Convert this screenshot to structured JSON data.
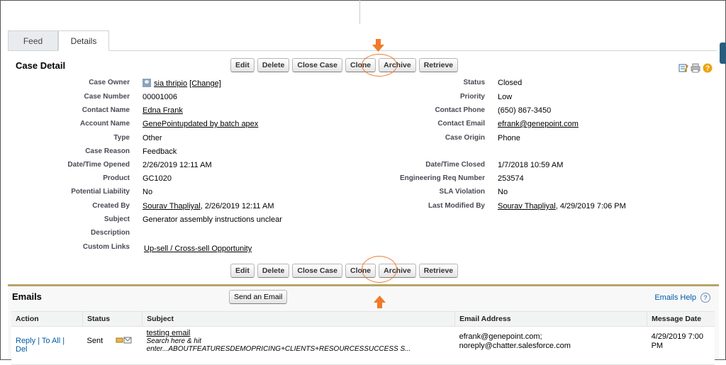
{
  "tabs": [
    "Feed",
    "Details"
  ],
  "case_detail": {
    "title": "Case Detail",
    "buttons": [
      "Edit",
      "Delete",
      "Close Case",
      "Clone",
      "Archive",
      "Retrieve"
    ],
    "left_fields": [
      {
        "label": "Case Owner",
        "value": "sia thripio",
        "extra": "[Change]"
      },
      {
        "label": "Case Number",
        "value": "00001006"
      },
      {
        "label": "Contact Name",
        "value": "Edna Frank"
      },
      {
        "label": "Account Name",
        "value": "GenePointupdated by batch apex"
      },
      {
        "label": "Type",
        "value": "Other"
      },
      {
        "label": "Case Reason",
        "value": "Feedback"
      },
      {
        "label": "Date/Time Opened",
        "value": "2/26/2019 12:11 AM"
      },
      {
        "label": "Product",
        "value": "GC1020"
      },
      {
        "label": "Potential Liability",
        "value": "No"
      },
      {
        "label": "Created By",
        "value": "Sourav Thapliyal",
        "extra": ", 2/26/2019 12:11 AM"
      },
      {
        "label": "Subject",
        "value": "Generator assembly instructions unclear"
      },
      {
        "label": "Description",
        "value": ""
      },
      {
        "label": "Custom Links",
        "value": "Up-sell / Cross-sell Opportunity"
      }
    ],
    "right_fields": [
      {
        "label": "Status",
        "value": "Closed"
      },
      {
        "label": "Priority",
        "value": "Low"
      },
      {
        "label": "Contact Phone",
        "value": "(650) 867-3450"
      },
      {
        "label": "Contact Email",
        "value": "efrank@genepoint.com"
      },
      {
        "label": "Case Origin",
        "value": "Phone"
      },
      {
        "label": "Date/Time Closed",
        "value": "1/7/2018 10:59 AM"
      },
      {
        "label": "Engineering Req Number",
        "value": "253574"
      },
      {
        "label": "SLA Violation",
        "value": "No"
      },
      {
        "label": "Last Modified By",
        "value": "Sourav Thapliyal",
        "extra": ", 4/29/2019 7:06 PM"
      }
    ]
  },
  "emails": {
    "title": "Emails",
    "send_button": "Send an Email",
    "help_link": "Emails Help",
    "help_icon": "?",
    "columns": [
      "Action",
      "Status",
      "Subject",
      "Email Address",
      "Message Date"
    ],
    "rows": [
      {
        "actions": [
          "Reply",
          "To All",
          "Del"
        ],
        "separator": "|",
        "status": "Sent",
        "subject": "testing email",
        "snippet": "Search here & hit enter...ABOUTFEATURESDEMOPRICING+CLIENTS+RESOURCESSUCCESS S...",
        "email_address": "efrank@genepoint.com; noreply@chatter.salesforce.com",
        "message_date": "4/29/2019 7:00 PM"
      }
    ]
  },
  "colors": {
    "highlight": "#f07a2a",
    "link": "#015ba7",
    "emails_border": "#b8a36a"
  }
}
